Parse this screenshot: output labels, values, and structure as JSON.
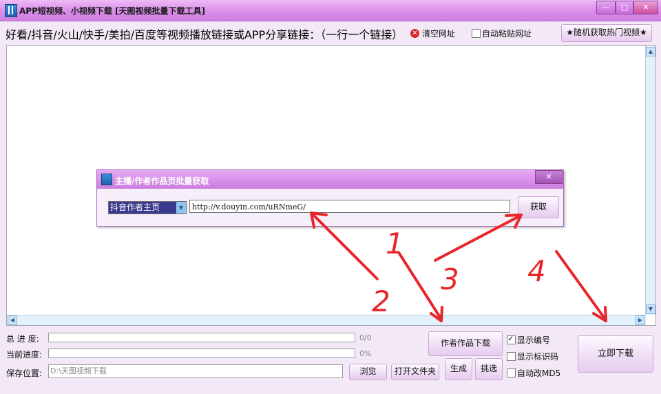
{
  "window": {
    "title": "APP短视频、小视频下载 [天图视频批量下载工具]",
    "buttons": {
      "minimize": "—",
      "maximize": "□",
      "close": "✕"
    }
  },
  "toolbar": {
    "label": "好看/抖音/火山/快手/美拍/百度等视频播放链接或APP分享链接：（一行一个链接）",
    "clear_urls": "清空网址",
    "auto_paste": {
      "label": "自动粘贴网址",
      "checked": false
    },
    "random_hot": "★随机获取热门视频★"
  },
  "dialog": {
    "title": "主播/作者作品页批量获取",
    "close": "✕",
    "select_value": "抖音作者主页",
    "url_value": "http://v.douyin.com/uRNmeG/",
    "fetch_button": "获取"
  },
  "annotations": [
    "1",
    "2",
    "3",
    "4"
  ],
  "progress": {
    "total_label": "总 进 度:",
    "total_text": "0/0",
    "total_fraction": 0,
    "current_label": "当前进度:",
    "current_text": "0%",
    "current_fraction": 0,
    "save_label": "保存位置:",
    "save_path": "D:\\天图视频下载"
  },
  "buttons": {
    "browse": "浏览",
    "open_folder": "打开文件夹",
    "author_download": "作者作品下载",
    "generate": "生成",
    "pick": "挑选",
    "download_now": "立即下载"
  },
  "options": [
    {
      "label": "显示编号",
      "checked": true
    },
    {
      "label": "显示标识码",
      "checked": false
    },
    {
      "label": "自动改MD5",
      "checked": false
    }
  ],
  "colors": {
    "annotation_red": "#e8262a",
    "title_purple": "#d98de9",
    "dialog_title": "#cb7ddf"
  }
}
